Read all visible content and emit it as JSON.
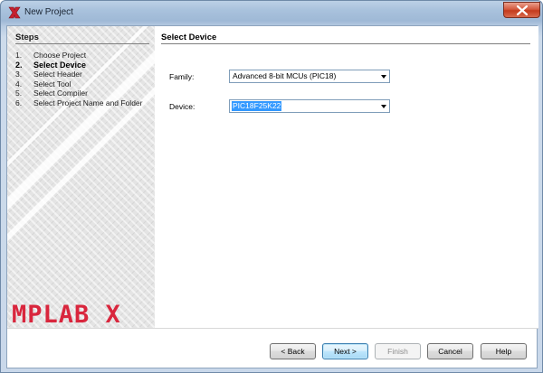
{
  "window": {
    "title": "New Project"
  },
  "steps": {
    "heading": "Steps",
    "items": [
      {
        "num": "1.",
        "label": "Choose Project",
        "current": false
      },
      {
        "num": "2.",
        "label": "Select Device",
        "current": true
      },
      {
        "num": "3.",
        "label": "Select Header",
        "current": false
      },
      {
        "num": "4.",
        "label": "Select Tool",
        "current": false
      },
      {
        "num": "5.",
        "label": "Select Compiler",
        "current": false
      },
      {
        "num": "6.",
        "label": "Select Project Name and Folder",
        "current": false
      }
    ]
  },
  "brand": {
    "logo_text": "MPLAB X",
    "color": "#d9263d"
  },
  "content": {
    "title": "Select Device",
    "family": {
      "label": "Family:",
      "value": "Advanced 8-bit MCUs (PIC18)"
    },
    "device": {
      "label": "Device:",
      "value": "PIC18F25K22"
    }
  },
  "buttons": {
    "back": "< Back",
    "next": "Next >",
    "finish": "Finish",
    "cancel": "Cancel",
    "help": "Help"
  },
  "colors": {
    "accent": "#3399ff",
    "close": "#c43b1d"
  }
}
